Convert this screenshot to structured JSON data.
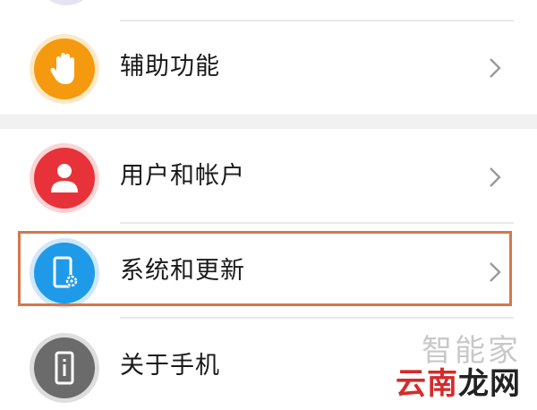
{
  "settings_list": {
    "items": [
      {
        "key": "accessibility",
        "label": "辅助功能",
        "icon": "hand-icon",
        "color": "#f59a0e"
      },
      {
        "key": "users",
        "label": "用户和帐户",
        "icon": "user-icon",
        "color": "#e8323a"
      },
      {
        "key": "system",
        "label": "系统和更新",
        "icon": "phone-settings-icon",
        "color": "#1e9ae8"
      },
      {
        "key": "about",
        "label": "关于手机",
        "icon": "phone-info-icon",
        "color": "#6b6b6b"
      }
    ]
  },
  "highlight": {
    "target": "system",
    "color": "#d3784b"
  },
  "watermark": {
    "line1": "智能家",
    "line2_red": "云南",
    "line2_dark": "龙网"
  }
}
